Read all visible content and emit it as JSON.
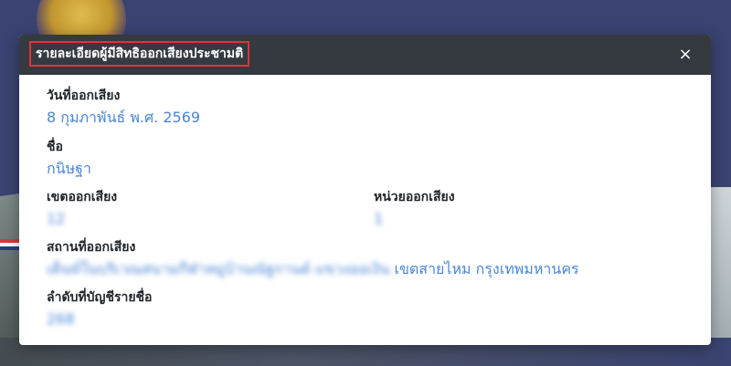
{
  "modal": {
    "title": "รายละเอียดผู้มีสิทธิออกเสียงประชามติ",
    "close_label": "×"
  },
  "fields": {
    "vote_date": {
      "label": "วันที่ออกเสียง",
      "value": "8 กุมภาพันธ์ พ.ศ. 2569"
    },
    "name": {
      "label": "ชื่อ",
      "value": "กนิษฐา"
    },
    "district_unit": {
      "label": "เขตออกเสียง",
      "value": "12"
    },
    "polling_unit": {
      "label": "หน่วยออกเสียง",
      "value": "1"
    },
    "location": {
      "label": "สถานที่ออกเสียง",
      "value_hidden": "เต็นท์ในบริเวณสนามกีฬาหมู่บ้านณัฐกานต์ แขวงออเงิน",
      "value_visible": "เขตสายไหม กรุงเทพมหานคร"
    },
    "list_order": {
      "label": "ลำดับที่บัญชีรายชื่อ",
      "value": "268"
    }
  },
  "colors": {
    "header_bg": "#343a40",
    "value_text": "#4a86d4",
    "title_highlight": "#e0343a"
  }
}
